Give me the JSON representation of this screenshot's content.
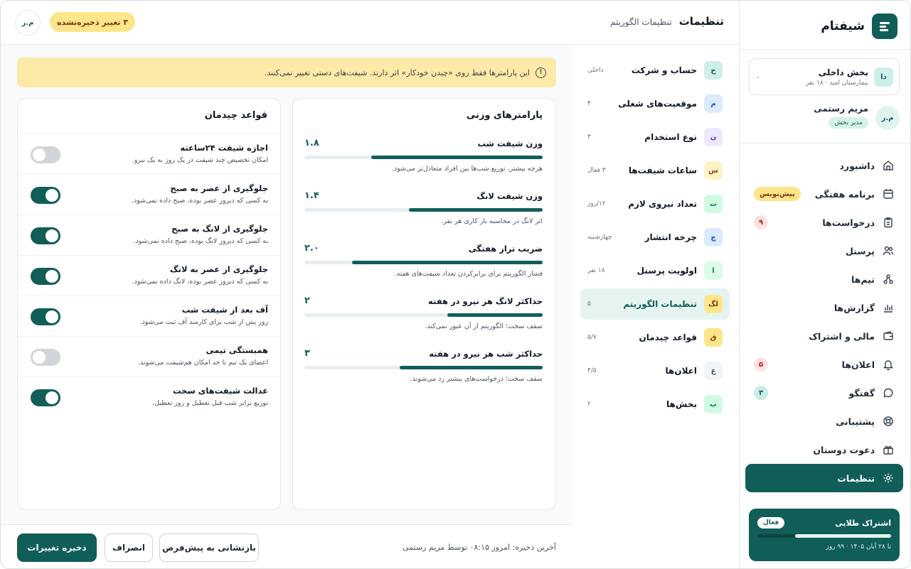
{
  "brand": {
    "name": "شیفتام"
  },
  "department": {
    "name": "بخش داخلی",
    "subtitle": "بیمارستان امید · ۱۸ نفر"
  },
  "user": {
    "initials": "م.ر",
    "name": "مریم رستمی",
    "role": "مدیر بخش"
  },
  "nav": [
    {
      "label": "داشبورد",
      "icon": "home-icon"
    },
    {
      "label": "برنامه هفتگی",
      "icon": "calendar-icon",
      "badge": "پیش‌نویس",
      "badge_style": "yellow"
    },
    {
      "label": "درخواست‌ها",
      "icon": "clipboard-icon",
      "badge": "۹",
      "badge_style": "red"
    },
    {
      "label": "پرسنل",
      "icon": "users-icon"
    },
    {
      "label": "تیم‌ها",
      "icon": "teams-icon"
    },
    {
      "label": "گزارش‌ها",
      "icon": "chart-icon"
    },
    {
      "label": "مالی و اشتراک",
      "icon": "wallet-icon"
    },
    {
      "label": "اعلان‌ها",
      "icon": "bell-icon",
      "badge": "۵",
      "badge_style": "red"
    },
    {
      "label": "گفتگو",
      "icon": "chat-icon",
      "badge": "۳",
      "badge_style": "teal"
    },
    {
      "label": "پشتیبانی",
      "icon": "lifebuoy-icon"
    },
    {
      "label": "دعوت دوستان",
      "icon": "gift-icon"
    },
    {
      "label": "تنظیمات",
      "icon": "gear-icon",
      "active": true
    }
  ],
  "subscription": {
    "title": "اشتراک طلایی",
    "status": "فعال",
    "progress": 0.72,
    "expiry": "تا ۲۸ آبان ۱۴۰۵ · ۹۹ روز"
  },
  "header": {
    "title": "تنظیمات",
    "breadcrumb": "تنظیمات الگوریتم",
    "unsaved": "۳ تغییر ذخیره‌نشده",
    "avatar": "م.ر"
  },
  "settings_menu": [
    {
      "letter": "ح",
      "label": "حساب و شرکت",
      "meta": "داخلی",
      "bg": "#cdeee9",
      "fg": "#115e59"
    },
    {
      "letter": "م",
      "label": "موقعیت‌های شغلی",
      "meta": "۴",
      "bg": "#dbeafe",
      "fg": "#1d4ed8"
    },
    {
      "letter": "ن",
      "label": "نوع استخدام",
      "meta": "۳",
      "bg": "#ede9fe",
      "fg": "#6d28d9"
    },
    {
      "letter": "س",
      "label": "ساعات شیفت‌ها",
      "meta": "۳ فعال",
      "bg": "#fef3c7",
      "fg": "#92400e"
    },
    {
      "letter": "ت",
      "label": "تعداد نیروی لازم",
      "meta": "۱۲/روز",
      "bg": "#d1fae5",
      "fg": "#047857"
    },
    {
      "letter": "چ",
      "label": "چرخه انتشار",
      "meta": "چهارشنبه",
      "bg": "#dbeafe",
      "fg": "#1d4ed8"
    },
    {
      "letter": "ا",
      "label": "اولویت پرسنل",
      "meta": "۱۸ نفر",
      "bg": "#dcfce7",
      "fg": "#15803d"
    },
    {
      "letter": "لگ",
      "label": "تنظیمات الگوریتم",
      "meta": "۵",
      "bg": "#fde68a",
      "fg": "#78350f",
      "active": true
    },
    {
      "letter": "ق",
      "label": "قواعد چیدمان",
      "meta": "۵/۷",
      "bg": "#fde68a",
      "fg": "#92400e"
    },
    {
      "letter": "ع",
      "label": "اعلان‌ها",
      "meta": "۴/۵",
      "bg": "#f1f5f9",
      "fg": "#475569"
    },
    {
      "letter": "ب",
      "label": "بخش‌ها",
      "meta": "۲",
      "bg": "#d1fae5",
      "fg": "#047857"
    }
  ],
  "info": {
    "text": "این پارامترها فقط روی «چیدن خودکار» اثر دارند. شیفت‌های دستی تغییر نمی‌کنند."
  },
  "weights": {
    "title": "پارامترهای وزنی",
    "items": [
      {
        "label": "وزن شیفت شب",
        "value": "۱.۸",
        "fraction": 0.72,
        "desc": "هرچه بیشتر، توزیع شب‌ها بین افراد متعادل‌تر می‌شود."
      },
      {
        "label": "وزن شیفت لانگ",
        "value": "۱.۴",
        "fraction": 0.56,
        "desc": "اثر لانگ در محاسبه بار کاری هر نفر."
      },
      {
        "label": "ضریب تراز هفتگی",
        "value": "۲.۰",
        "fraction": 0.8,
        "desc": "فشار الگوریتم برای برابرکردن تعداد شیفت‌های هفته."
      },
      {
        "label": "حداکثر لانگ هر نیرو در هفته",
        "value": "۲",
        "fraction": 0.4,
        "desc": "سقف سخت؛ الگوریتم از آن عبور نمی‌کند."
      },
      {
        "label": "حداکثر شب هر نیرو در هفته",
        "value": "۳",
        "fraction": 0.6,
        "desc": "سقف سخت؛ درخواست‌های بیشتر رد می‌شوند."
      }
    ]
  },
  "rules": {
    "title": "قواعد چیدمان",
    "items": [
      {
        "label": "اجازه شیفت ۲۴ساعته",
        "desc": "امکان تخصیص چند شیفت در یک روز به یک نیرو.",
        "on": false
      },
      {
        "label": "جلوگیری از عصر به صبح",
        "desc": "به کسی که دیروز عصر بوده، صبح داده نمی‌شود.",
        "on": true
      },
      {
        "label": "جلوگیری از لانگ به صبح",
        "desc": "به کسی که دیروز لانگ بوده، صبح داده نمی‌شود.",
        "on": true
      },
      {
        "label": "جلوگیری از عصر به لانگ",
        "desc": "به کسی که دیروز عصر بوده، لانگ داده نمی‌شود.",
        "on": true
      },
      {
        "label": "آف بعد از شیفت شب",
        "desc": "روز پس از شب برای کارمند آف ثبت می‌شود.",
        "on": true
      },
      {
        "label": "همبستگی تیمی",
        "desc": "اعضای یک تیم تا حد امکان هم‌شیفت می‌شوند.",
        "on": false
      },
      {
        "label": "عدالت شیفت‌های سخت",
        "desc": "توزیع برابر شب قبل تعطیل و روز تعطیل.",
        "on": true
      }
    ]
  },
  "footer": {
    "last_save": "آخرین ذخیره: امروز ۰۸:۱۵ توسط مریم رستمی",
    "reset": "بازنشانی به پیش‌فرض",
    "cancel": "انصراف",
    "save": "ذخیره تغییرات"
  }
}
